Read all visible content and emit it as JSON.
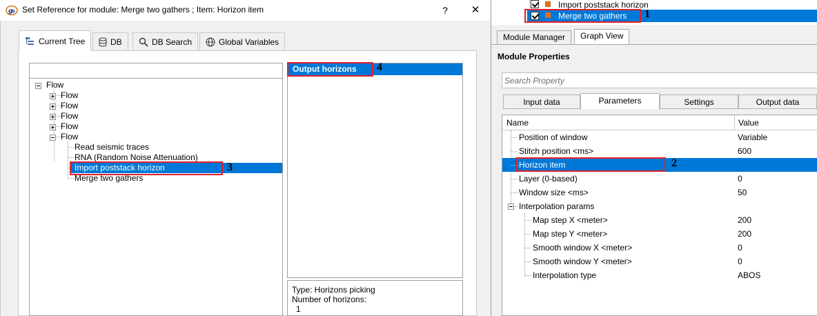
{
  "dialog": {
    "title": "Set Reference for module: Merge two gathers ; Item: Horizon item",
    "help_label": "?",
    "close_label": "✕",
    "tabs": [
      {
        "label": "Current Tree",
        "icon": "tree-icon"
      },
      {
        "label": "DB",
        "icon": "database-icon"
      },
      {
        "label": "DB Search",
        "icon": "search-icon"
      },
      {
        "label": "Global Variables",
        "icon": "globe-icon"
      }
    ],
    "tree": {
      "root": "Flow",
      "collapsed_flows": [
        "Flow",
        "Flow",
        "Flow",
        "Flow"
      ],
      "expanded_flow": "Flow",
      "modules": [
        "Read seismic traces",
        "RNA (Random Noise Attenuation)",
        "Import poststack horizon",
        "Merge two gathers"
      ]
    },
    "horizons": {
      "items": [
        "Output horizons"
      ]
    },
    "info": {
      "line1": "Type: Horizons picking",
      "line2": "Number of horizons:",
      "line3": "1"
    }
  },
  "right_panel": {
    "flow_items": [
      "Import poststack horizon",
      "Merge two gathers"
    ],
    "tabs": [
      "Module Manager",
      "Graph View"
    ],
    "section_title": "Module Properties",
    "search_placeholder": "Search Property",
    "prop_tabs": [
      "Input data",
      "Parameters",
      "Settings",
      "Output data"
    ],
    "grid_headers": {
      "name": "Name",
      "value": "Value"
    },
    "params": [
      {
        "name": "Position of window",
        "value": "Variable"
      },
      {
        "name": "Stitch position <ms>",
        "value": "600"
      },
      {
        "name": "Horizon item",
        "value": ""
      },
      {
        "name": "Layer (0-based)",
        "value": "0"
      },
      {
        "name": "Window size <ms>",
        "value": "50"
      },
      {
        "name": "Interpolation params",
        "value": ""
      },
      {
        "name": "Map step X <meter>",
        "value": "200"
      },
      {
        "name": "Map step Y <meter>",
        "value": "200"
      },
      {
        "name": "Smooth window X <meter>",
        "value": "0"
      },
      {
        "name": "Smooth window Y <meter>",
        "value": "0"
      },
      {
        "name": "Interpolation type",
        "value": "ABOS"
      }
    ]
  },
  "annotations": [
    "1",
    "2",
    "3",
    "4"
  ],
  "colors": {
    "selection": "#0078d7",
    "highlight_box": "#e0202a",
    "module_square": "#e36c1c"
  }
}
